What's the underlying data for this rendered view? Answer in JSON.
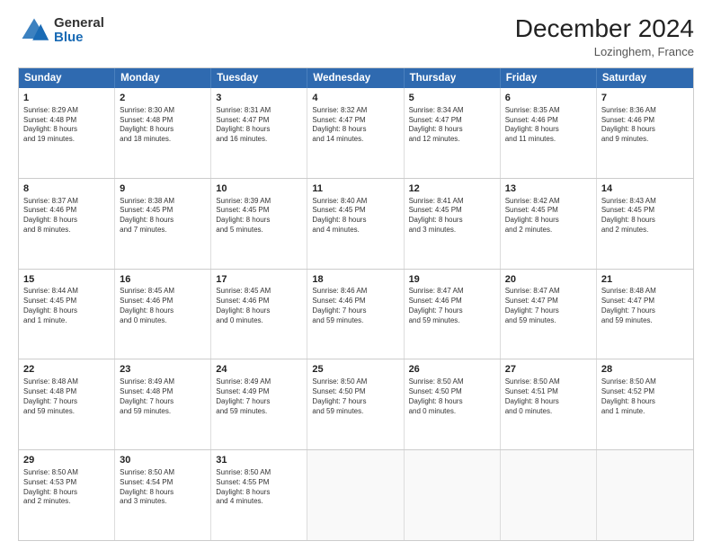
{
  "header": {
    "logo_general": "General",
    "logo_blue": "Blue",
    "title": "December 2024",
    "location": "Lozinghem, France"
  },
  "days_of_week": [
    "Sunday",
    "Monday",
    "Tuesday",
    "Wednesday",
    "Thursday",
    "Friday",
    "Saturday"
  ],
  "weeks": [
    [
      {
        "day": "1",
        "lines": [
          "Sunrise: 8:29 AM",
          "Sunset: 4:48 PM",
          "Daylight: 8 hours",
          "and 19 minutes."
        ]
      },
      {
        "day": "2",
        "lines": [
          "Sunrise: 8:30 AM",
          "Sunset: 4:48 PM",
          "Daylight: 8 hours",
          "and 18 minutes."
        ]
      },
      {
        "day": "3",
        "lines": [
          "Sunrise: 8:31 AM",
          "Sunset: 4:47 PM",
          "Daylight: 8 hours",
          "and 16 minutes."
        ]
      },
      {
        "day": "4",
        "lines": [
          "Sunrise: 8:32 AM",
          "Sunset: 4:47 PM",
          "Daylight: 8 hours",
          "and 14 minutes."
        ]
      },
      {
        "day": "5",
        "lines": [
          "Sunrise: 8:34 AM",
          "Sunset: 4:47 PM",
          "Daylight: 8 hours",
          "and 12 minutes."
        ]
      },
      {
        "day": "6",
        "lines": [
          "Sunrise: 8:35 AM",
          "Sunset: 4:46 PM",
          "Daylight: 8 hours",
          "and 11 minutes."
        ]
      },
      {
        "day": "7",
        "lines": [
          "Sunrise: 8:36 AM",
          "Sunset: 4:46 PM",
          "Daylight: 8 hours",
          "and 9 minutes."
        ]
      }
    ],
    [
      {
        "day": "8",
        "lines": [
          "Sunrise: 8:37 AM",
          "Sunset: 4:46 PM",
          "Daylight: 8 hours",
          "and 8 minutes."
        ]
      },
      {
        "day": "9",
        "lines": [
          "Sunrise: 8:38 AM",
          "Sunset: 4:45 PM",
          "Daylight: 8 hours",
          "and 7 minutes."
        ]
      },
      {
        "day": "10",
        "lines": [
          "Sunrise: 8:39 AM",
          "Sunset: 4:45 PM",
          "Daylight: 8 hours",
          "and 5 minutes."
        ]
      },
      {
        "day": "11",
        "lines": [
          "Sunrise: 8:40 AM",
          "Sunset: 4:45 PM",
          "Daylight: 8 hours",
          "and 4 minutes."
        ]
      },
      {
        "day": "12",
        "lines": [
          "Sunrise: 8:41 AM",
          "Sunset: 4:45 PM",
          "Daylight: 8 hours",
          "and 3 minutes."
        ]
      },
      {
        "day": "13",
        "lines": [
          "Sunrise: 8:42 AM",
          "Sunset: 4:45 PM",
          "Daylight: 8 hours",
          "and 2 minutes."
        ]
      },
      {
        "day": "14",
        "lines": [
          "Sunrise: 8:43 AM",
          "Sunset: 4:45 PM",
          "Daylight: 8 hours",
          "and 2 minutes."
        ]
      }
    ],
    [
      {
        "day": "15",
        "lines": [
          "Sunrise: 8:44 AM",
          "Sunset: 4:45 PM",
          "Daylight: 8 hours",
          "and 1 minute."
        ]
      },
      {
        "day": "16",
        "lines": [
          "Sunrise: 8:45 AM",
          "Sunset: 4:46 PM",
          "Daylight: 8 hours",
          "and 0 minutes."
        ]
      },
      {
        "day": "17",
        "lines": [
          "Sunrise: 8:45 AM",
          "Sunset: 4:46 PM",
          "Daylight: 8 hours",
          "and 0 minutes."
        ]
      },
      {
        "day": "18",
        "lines": [
          "Sunrise: 8:46 AM",
          "Sunset: 4:46 PM",
          "Daylight: 7 hours",
          "and 59 minutes."
        ]
      },
      {
        "day": "19",
        "lines": [
          "Sunrise: 8:47 AM",
          "Sunset: 4:46 PM",
          "Daylight: 7 hours",
          "and 59 minutes."
        ]
      },
      {
        "day": "20",
        "lines": [
          "Sunrise: 8:47 AM",
          "Sunset: 4:47 PM",
          "Daylight: 7 hours",
          "and 59 minutes."
        ]
      },
      {
        "day": "21",
        "lines": [
          "Sunrise: 8:48 AM",
          "Sunset: 4:47 PM",
          "Daylight: 7 hours",
          "and 59 minutes."
        ]
      }
    ],
    [
      {
        "day": "22",
        "lines": [
          "Sunrise: 8:48 AM",
          "Sunset: 4:48 PM",
          "Daylight: 7 hours",
          "and 59 minutes."
        ]
      },
      {
        "day": "23",
        "lines": [
          "Sunrise: 8:49 AM",
          "Sunset: 4:48 PM",
          "Daylight: 7 hours",
          "and 59 minutes."
        ]
      },
      {
        "day": "24",
        "lines": [
          "Sunrise: 8:49 AM",
          "Sunset: 4:49 PM",
          "Daylight: 7 hours",
          "and 59 minutes."
        ]
      },
      {
        "day": "25",
        "lines": [
          "Sunrise: 8:50 AM",
          "Sunset: 4:50 PM",
          "Daylight: 7 hours",
          "and 59 minutes."
        ]
      },
      {
        "day": "26",
        "lines": [
          "Sunrise: 8:50 AM",
          "Sunset: 4:50 PM",
          "Daylight: 8 hours",
          "and 0 minutes."
        ]
      },
      {
        "day": "27",
        "lines": [
          "Sunrise: 8:50 AM",
          "Sunset: 4:51 PM",
          "Daylight: 8 hours",
          "and 0 minutes."
        ]
      },
      {
        "day": "28",
        "lines": [
          "Sunrise: 8:50 AM",
          "Sunset: 4:52 PM",
          "Daylight: 8 hours",
          "and 1 minute."
        ]
      }
    ],
    [
      {
        "day": "29",
        "lines": [
          "Sunrise: 8:50 AM",
          "Sunset: 4:53 PM",
          "Daylight: 8 hours",
          "and 2 minutes."
        ]
      },
      {
        "day": "30",
        "lines": [
          "Sunrise: 8:50 AM",
          "Sunset: 4:54 PM",
          "Daylight: 8 hours",
          "and 3 minutes."
        ]
      },
      {
        "day": "31",
        "lines": [
          "Sunrise: 8:50 AM",
          "Sunset: 4:55 PM",
          "Daylight: 8 hours",
          "and 4 minutes."
        ]
      },
      {
        "day": "",
        "lines": []
      },
      {
        "day": "",
        "lines": []
      },
      {
        "day": "",
        "lines": []
      },
      {
        "day": "",
        "lines": []
      }
    ]
  ]
}
